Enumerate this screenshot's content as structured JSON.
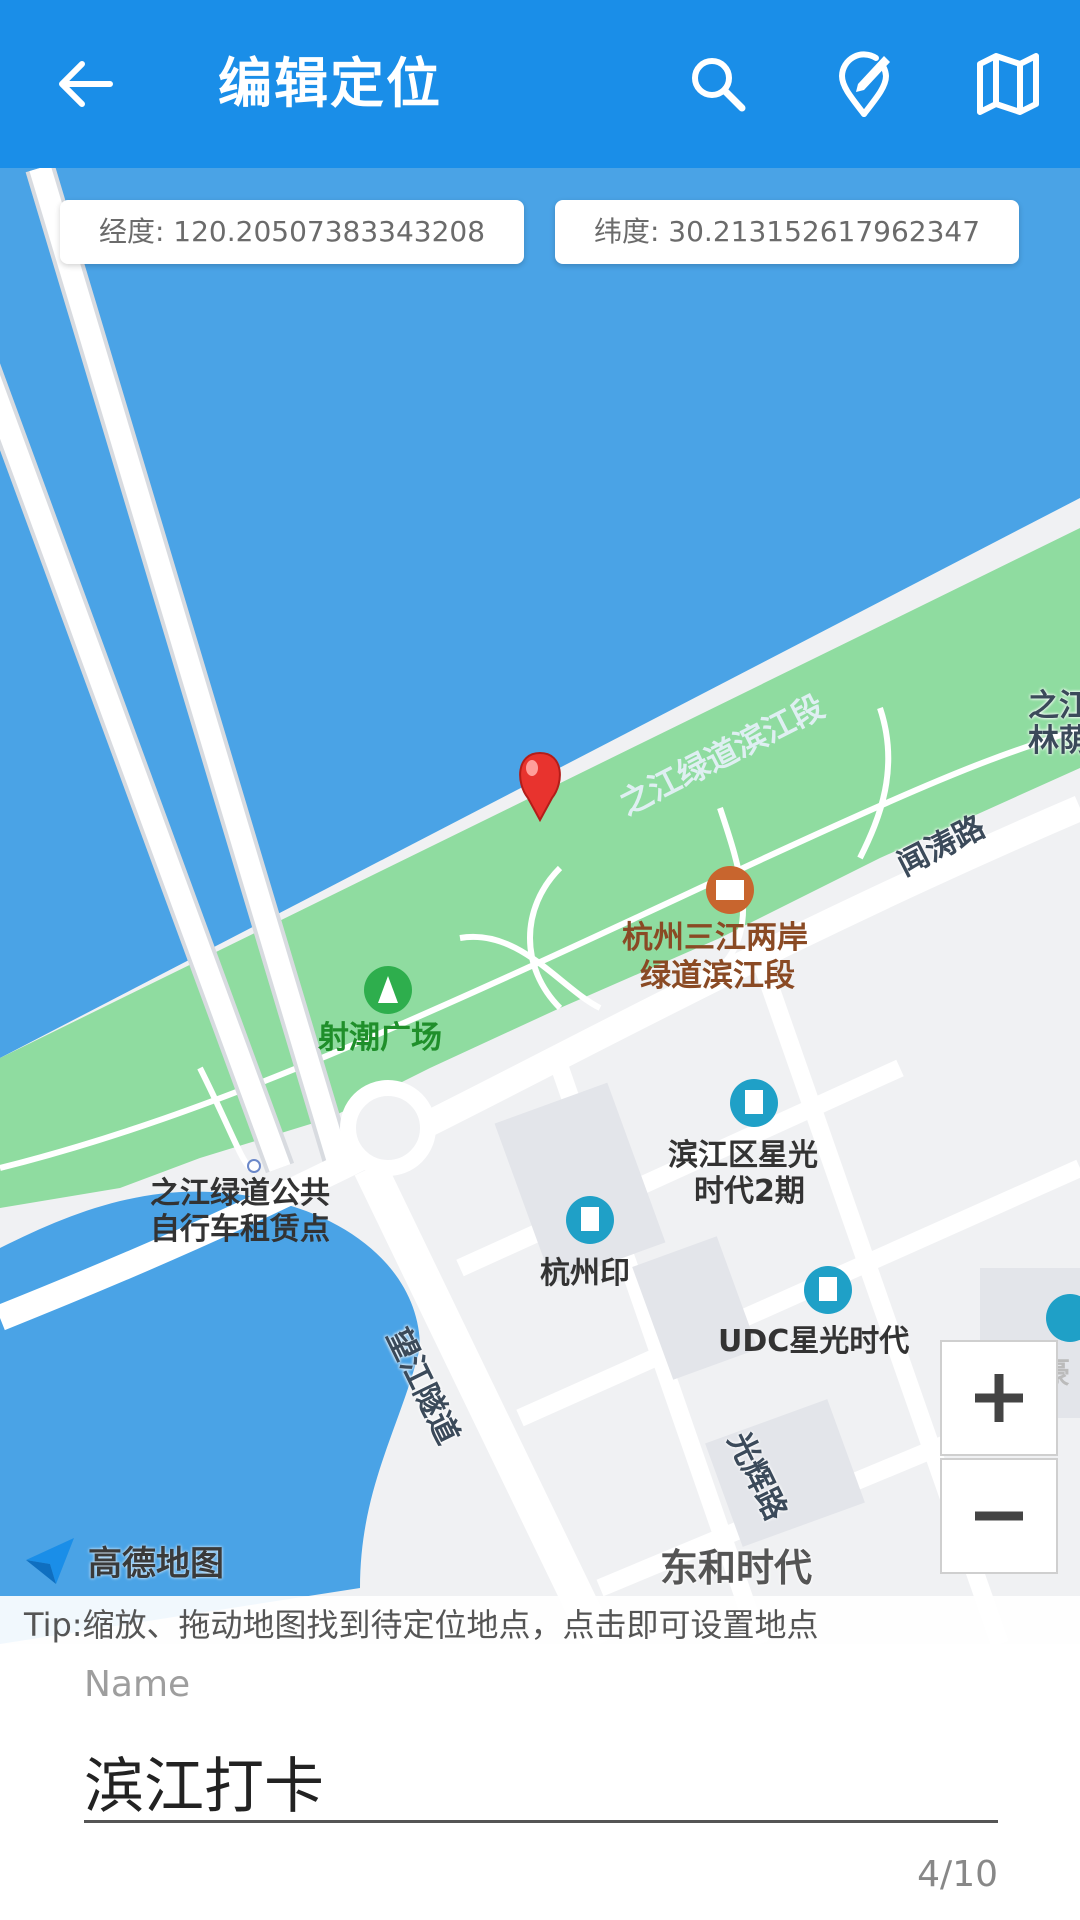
{
  "appbar": {
    "title": "编辑定位",
    "back_icon": "arrow-left-icon",
    "actions": [
      "search-icon",
      "edit-location-icon",
      "map-icon"
    ],
    "color": "#1a8ee8"
  },
  "map": {
    "longitude_text": "经度: 120.20507383343208",
    "latitude_text": "纬度: 30.213152617962347",
    "labels": {
      "greenway": "之江绿道滨江段",
      "zhijiang_partial_1": "之江",
      "zhijiang_partial_2": "林荫",
      "wentao_road": "闻涛路",
      "sanjiang_1": "杭州三江两岸",
      "sanjiang_2": "绿道滨江段",
      "shechao": "射潮广场",
      "bike_1": "之江绿道公共",
      "bike_2": "自行车租赁点",
      "xingguang_1": "滨江区星光",
      "xingguang_2": "时代2期",
      "hangzhouyin": "杭州印",
      "udc": "UDC星光时代",
      "tunnel": "望江隧道",
      "guanghui": "光辉路",
      "donghe": "东和时代",
      "minghao": "明豪"
    },
    "logo_text": "高德地图",
    "tip": "Tip:缩放、拖动地图找到待定位地点，点击即可设置地点",
    "zoom_in": "+",
    "zoom_out": "−",
    "colors": {
      "water": "#4aa3e6",
      "park": "#8fdca0",
      "land": "#f0f1f3",
      "road": "#ffffff",
      "pin": "#e8332e"
    }
  },
  "form": {
    "name_label": "Name",
    "name_value": "滨江打卡",
    "counter": "4/10"
  }
}
